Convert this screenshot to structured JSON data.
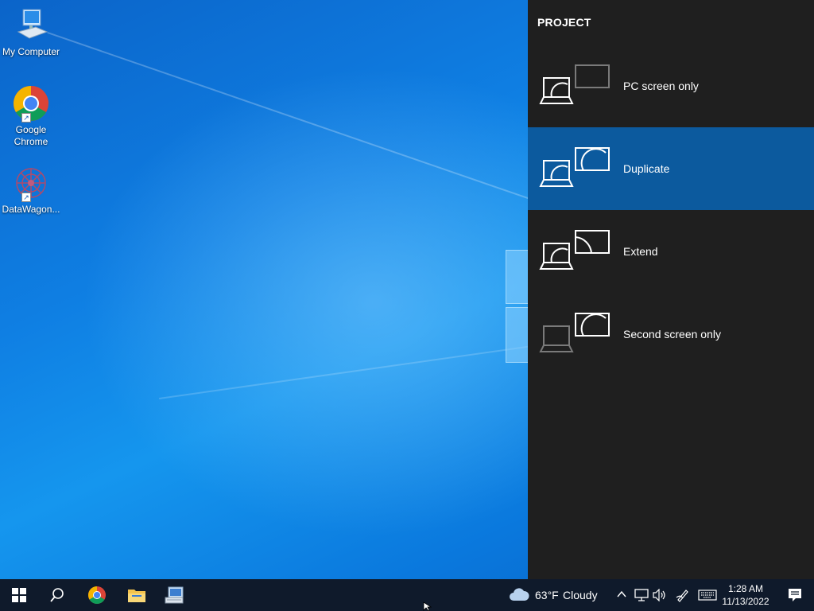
{
  "desktop": {
    "icons": [
      {
        "label": "My Computer",
        "icon": "computer-icon"
      },
      {
        "label": "Google Chrome",
        "icon": "chrome-icon"
      },
      {
        "label": "DataWagon...",
        "icon": "datawagon-icon"
      }
    ]
  },
  "project": {
    "title": "PROJECT",
    "options": [
      {
        "label": "PC screen only",
        "icon": "pc-screen-only-icon",
        "selected": false
      },
      {
        "label": "Duplicate",
        "icon": "duplicate-icon",
        "selected": true
      },
      {
        "label": "Extend",
        "icon": "extend-icon",
        "selected": false
      },
      {
        "label": "Second screen only",
        "icon": "second-screen-only-icon",
        "selected": false
      }
    ],
    "colors": {
      "panel_bg": "#1f1f1f",
      "selected_bg": "#0c5a9e"
    }
  },
  "taskbar": {
    "buttons": [
      {
        "name": "start-button",
        "icon": "windows-logo-icon"
      },
      {
        "name": "search-button",
        "icon": "search-icon"
      },
      {
        "name": "chrome-taskbar-button",
        "icon": "chrome-icon"
      },
      {
        "name": "file-explorer-button",
        "icon": "folder-icon"
      },
      {
        "name": "remote-app-button",
        "icon": "keyboard-monitor-icon"
      }
    ],
    "weather": {
      "temp": "63°F",
      "condition": "Cloudy",
      "icon": "cloud-icon"
    },
    "tray_icons": [
      "chevron-up-icon",
      "network-icon",
      "volume-icon",
      "pen-icon",
      "keyboard-icon"
    ],
    "clock": {
      "time": "1:28 AM",
      "date": "11/13/2022"
    },
    "notification_icon": "notification-icon"
  }
}
